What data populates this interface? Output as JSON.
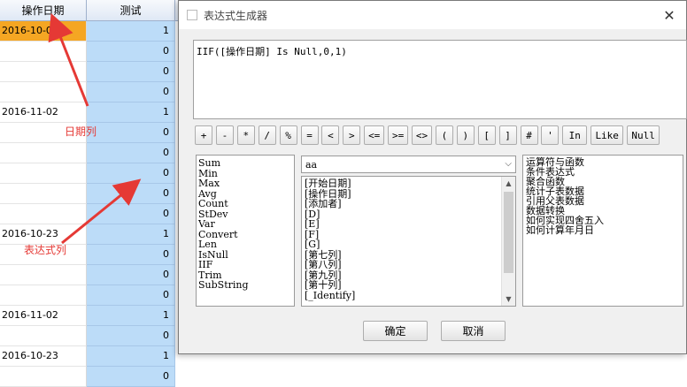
{
  "grid": {
    "headers": {
      "date": "操作日期",
      "test": "测试"
    },
    "rows": [
      {
        "date": "2016-10-05",
        "test": "1",
        "selected": true
      },
      {
        "date": "",
        "test": "0"
      },
      {
        "date": "",
        "test": "0"
      },
      {
        "date": "",
        "test": "0"
      },
      {
        "date": "2016-11-02",
        "test": "1"
      },
      {
        "date": "",
        "test": "0"
      },
      {
        "date": "",
        "test": "0"
      },
      {
        "date": "",
        "test": "0"
      },
      {
        "date": "",
        "test": "0"
      },
      {
        "date": "",
        "test": "0"
      },
      {
        "date": "2016-10-23",
        "test": "1"
      },
      {
        "date": "",
        "test": "0"
      },
      {
        "date": "",
        "test": "0"
      },
      {
        "date": "",
        "test": "0"
      },
      {
        "date": "2016-11-02",
        "test": "1"
      },
      {
        "date": "",
        "test": "0"
      },
      {
        "date": "2016-10-23",
        "test": "1"
      },
      {
        "date": "",
        "test": "0"
      }
    ]
  },
  "annotations": {
    "date_column": "日期列",
    "expression_column": "表达式列"
  },
  "dialog": {
    "title": "表达式生成器",
    "close_glyph": "✕",
    "expression": "IIF([操作日期] Is Null,0,1)",
    "operators": [
      "+",
      "-",
      "*",
      "/",
      "%",
      "=",
      "<",
      ">",
      "<=",
      ">=",
      "<>",
      "(",
      ")",
      "[",
      "]",
      "#",
      "'",
      "In",
      "Like",
      "Null"
    ],
    "functions": [
      "Sum",
      "Min",
      "Max",
      "Avg",
      "Count",
      "StDev",
      "Var",
      "Convert",
      "Len",
      "IsNull",
      "IIF",
      "Trim",
      "SubString"
    ],
    "table_select": {
      "value": "aa",
      "icon": "chevron-down-icon"
    },
    "fields": [
      "[开始日期]",
      "[操作日期]",
      "[添加者]",
      "[D]",
      "[E]",
      "[F]",
      "[G]",
      "[第七列]",
      "[第八列]",
      "[第九列]",
      "[第十列]",
      "[_Identify]"
    ],
    "help_topics": [
      "运算符与函数",
      "条件表达式",
      "聚合函数",
      "统计子表数据",
      "引用父表数据",
      "数据转换",
      "如何实现四舍五入",
      "如何计算年月日"
    ],
    "ok_label": "确定",
    "cancel_label": "取消"
  },
  "colors": {
    "accent_red": "#e53935",
    "selected_row": "#f5a623",
    "test_column": "#bcdcf8"
  }
}
